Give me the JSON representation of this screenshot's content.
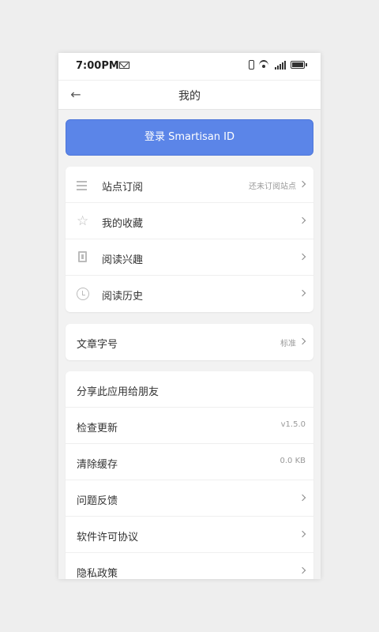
{
  "status_bar": {
    "time": "7:00PM"
  },
  "header": {
    "back_icon": "←",
    "title": "我的"
  },
  "login": {
    "label": "登录 Smartisan ID"
  },
  "menu1": [
    {
      "icon": "list-icon",
      "label": "站点订阅",
      "value": "还未订阅站点"
    },
    {
      "icon": "star-icon",
      "label": "我的收藏",
      "value": ""
    },
    {
      "icon": "book-icon",
      "label": "阅读兴趣",
      "value": ""
    },
    {
      "icon": "clock-icon",
      "label": "阅读历史",
      "value": ""
    }
  ],
  "menu2": [
    {
      "label": "文章字号",
      "value": "标准"
    }
  ],
  "menu3": [
    {
      "label": "分享此应用给朋友",
      "value": ""
    },
    {
      "label": "检查更新",
      "value": "v1.5.0"
    },
    {
      "label": "清除缓存",
      "value": "0.0 KB"
    },
    {
      "label": "问题反馈",
      "value": ""
    },
    {
      "label": "软件许可协议",
      "value": ""
    },
    {
      "label": "隐私政策",
      "value": ""
    }
  ],
  "colors": {
    "accent": "#5b85e8",
    "background": "#f2f2f2"
  }
}
